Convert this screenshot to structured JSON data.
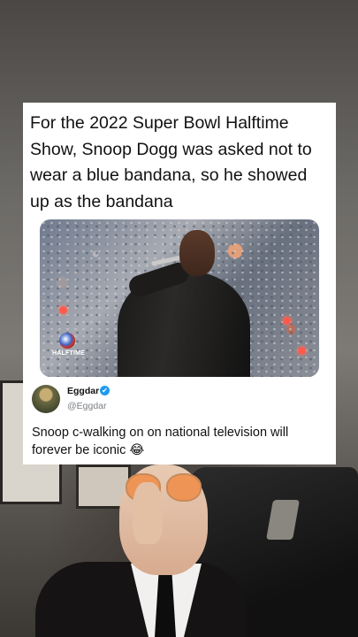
{
  "card": {
    "headline": "For the 2022 Super Bowl Halftime Show, Snoop Dogg was asked not to wear a blue bandana, so he showed up as the bandana",
    "media_logo_text": "HALFTIME"
  },
  "reply": {
    "user_name": "Eggdar",
    "handle": "@Eggdar",
    "verified_icon": "✔",
    "text": "Snoop c-walking on on national television will forever be iconic 😂"
  },
  "colors": {
    "card_bg": "#ffffff",
    "verified": "#1d9bf0",
    "handle": "#7a7f84"
  }
}
